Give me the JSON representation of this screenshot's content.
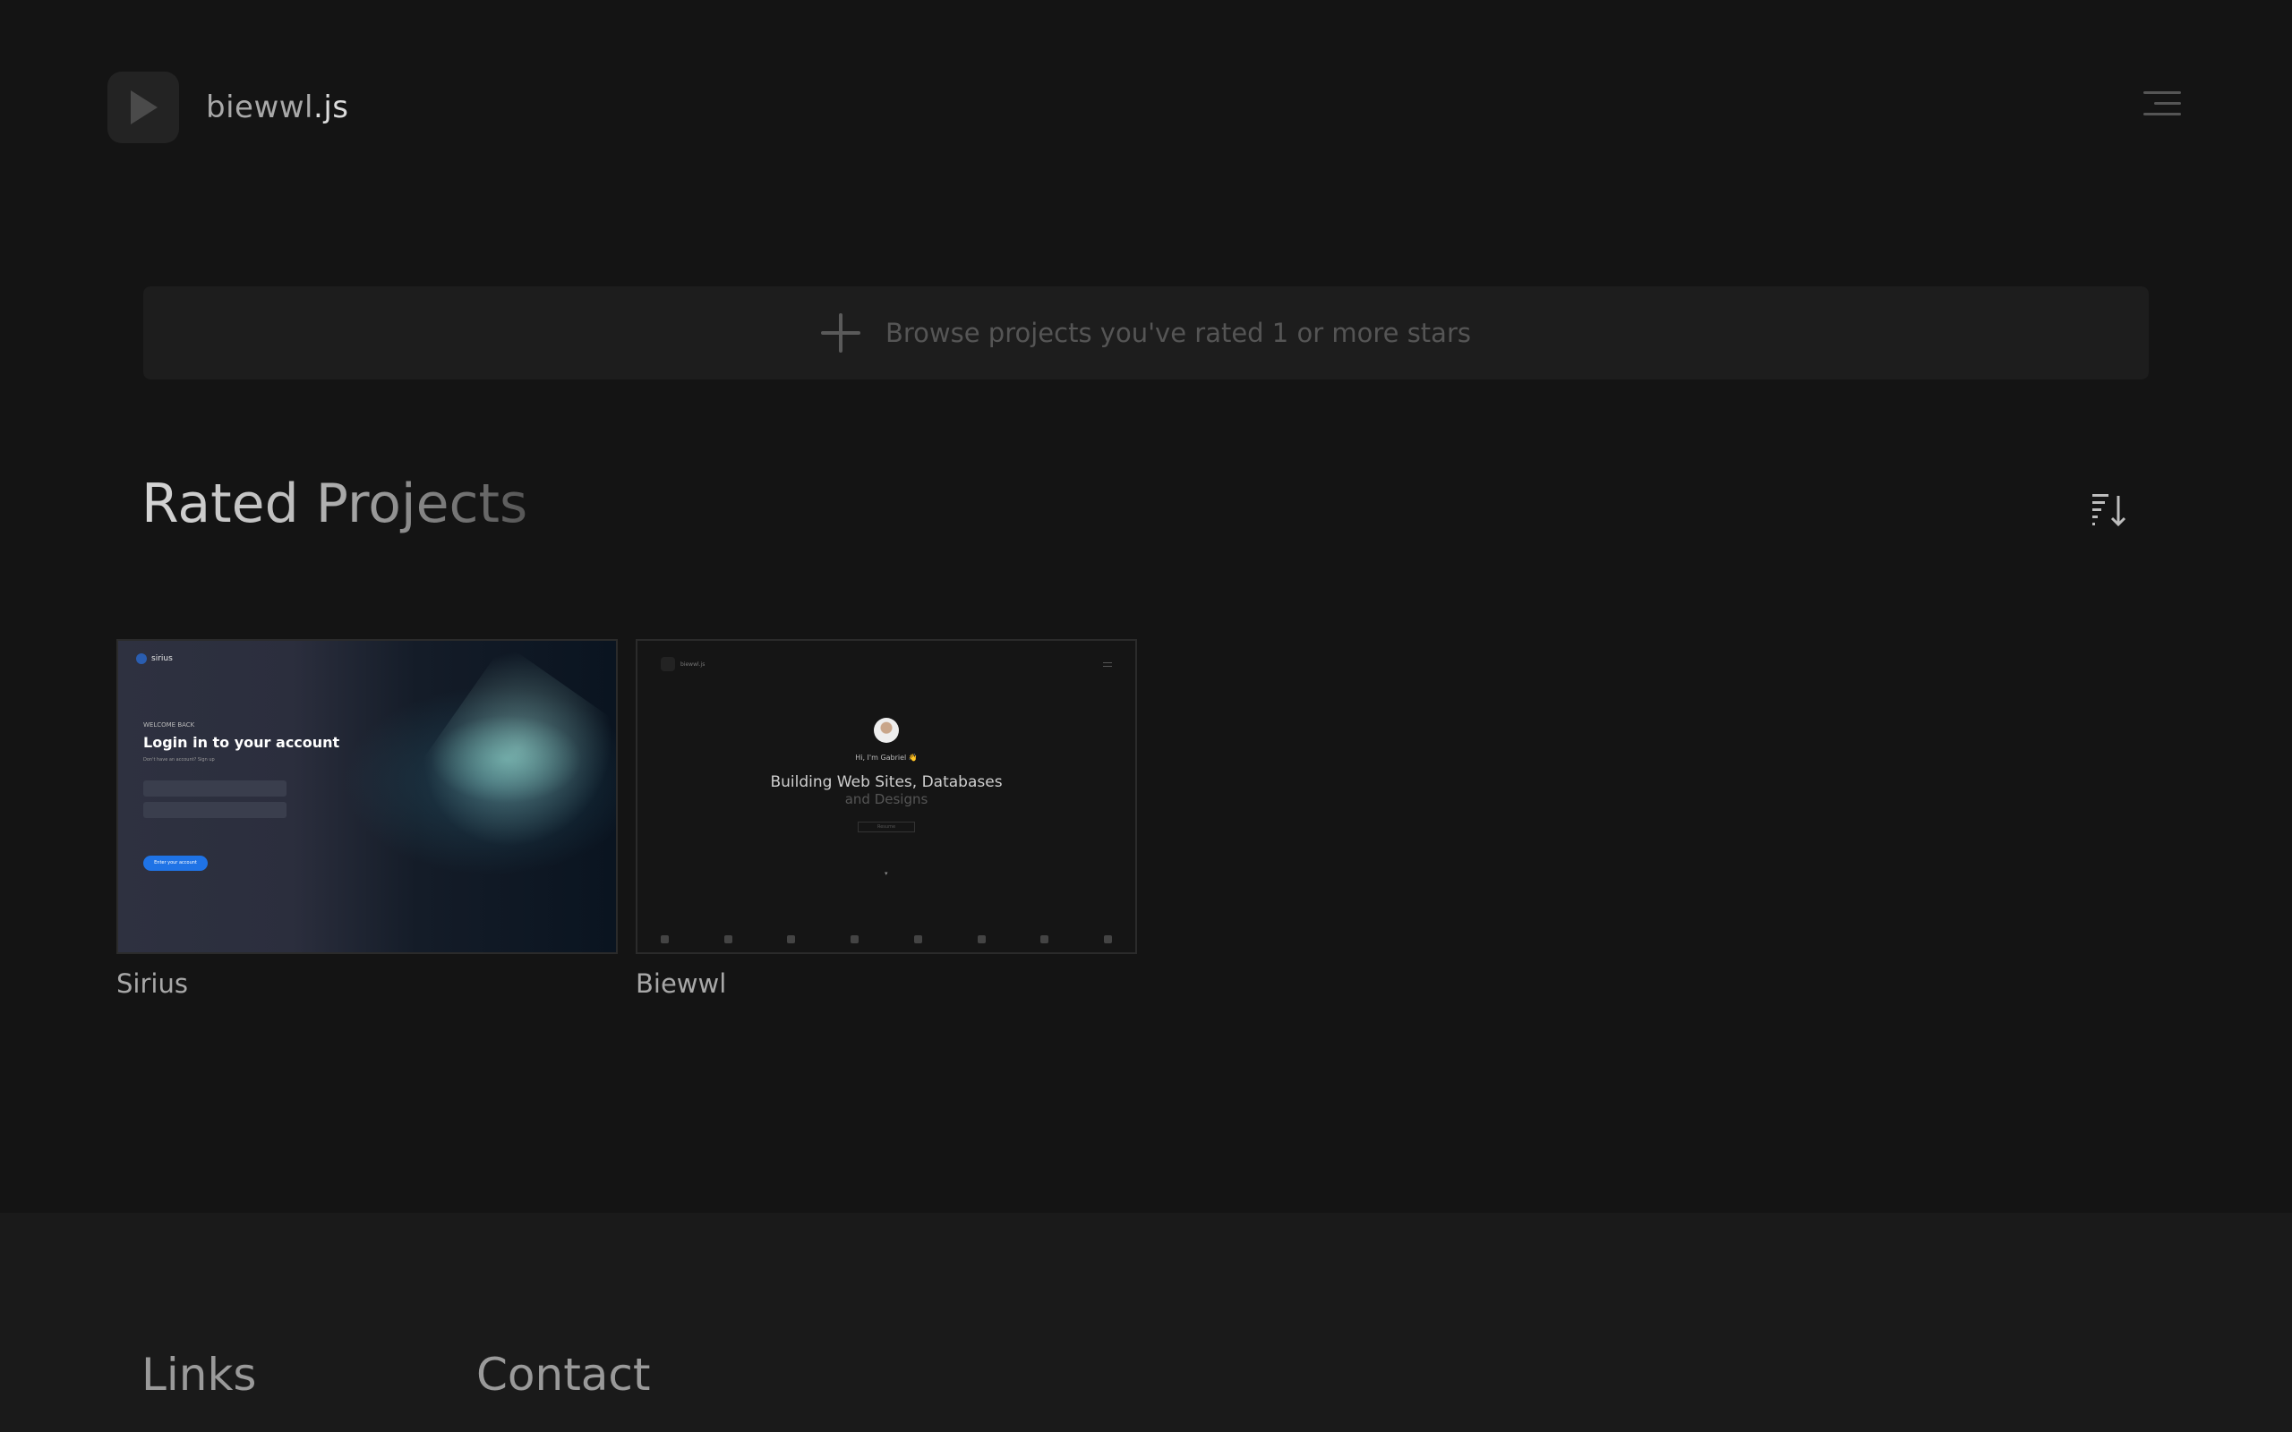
{
  "header": {
    "brand_name": "biewwl",
    "brand_suffix": ".js",
    "logo_icon": "play-icon",
    "menu_icon": "hamburger-menu-icon"
  },
  "browse": {
    "icon": "plus-icon",
    "label": "Browse projects you've rated 1 or more stars"
  },
  "section": {
    "title": "Rated Projects",
    "sort_icon": "sort-descending-icon"
  },
  "projects": [
    {
      "title": "Sirius",
      "preview": {
        "logo": "sirius",
        "welcome": "WELCOME BACK",
        "heading": "Login in to your account",
        "subtext": "Don't have an account? Sign up",
        "button": "Enter your account"
      }
    },
    {
      "title": "Biewwl",
      "preview": {
        "logo": "biewwl.js",
        "greeting": "Hi, I'm Gabriel 👋",
        "headline_1": "Building Web Sites, Databases",
        "headline_2": "and Designs",
        "button": "Resume"
      }
    }
  ],
  "footer": {
    "links_title": "Links",
    "contact_title": "Contact"
  },
  "colors": {
    "background": "#141414",
    "card_surface": "#1d1d1d",
    "footer_background": "#1a1a1a",
    "accent_blue": "#1f73e6"
  }
}
